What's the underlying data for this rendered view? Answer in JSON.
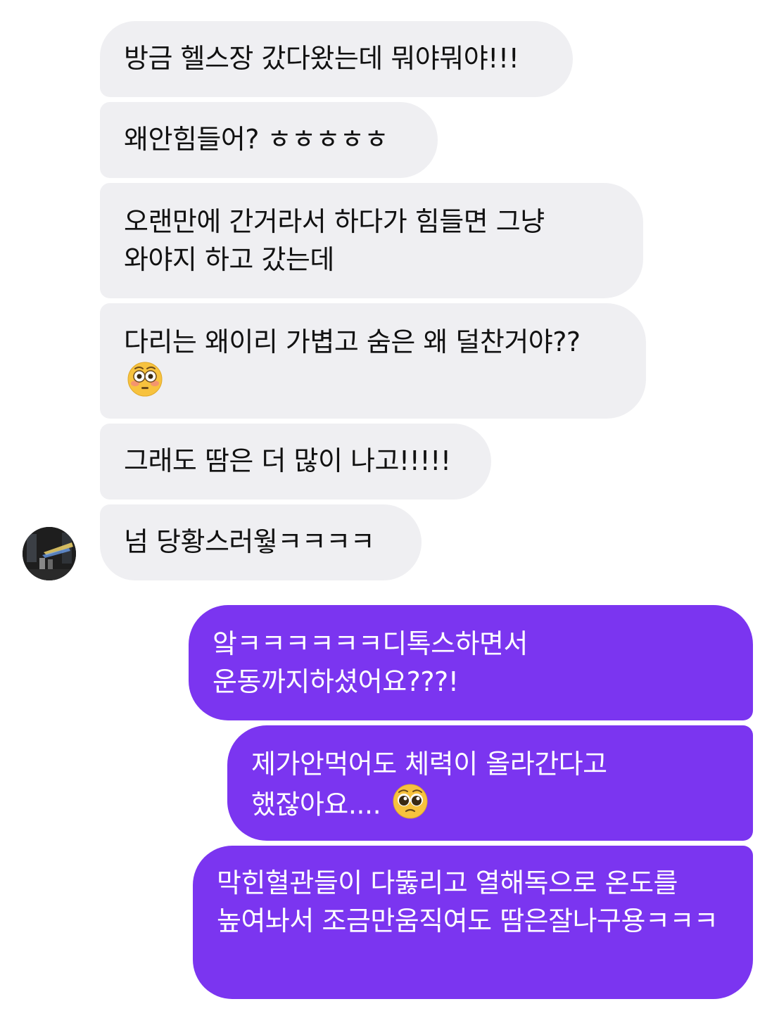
{
  "chat": {
    "incoming": [
      {
        "text": "방금 헬스장 갔다왔는데 뭐야뭐야!!!"
      },
      {
        "text": "왜안힘들어? ㅎㅎㅎㅎㅎ"
      },
      {
        "text": "오랜만에 간거라서 하다가 힘들면 그냥 와야지 하고 갔는데"
      },
      {
        "text": "다리는 왜이리 가볍고 숨은 왜 덜찬거야??",
        "emoji": "flushed-face"
      },
      {
        "text": "그래도 땀은 더 많이 나고!!!!!"
      },
      {
        "text": "넘 당황스러웧ㅋㅋㅋㅋ"
      }
    ],
    "outgoing": [
      {
        "text": "앜ㅋㅋㅋㅋㅋㅋ디톡스하면서 운동까지하셨어요???!"
      },
      {
        "text": "제가안먹어도 체력이 올라간다고 했잖아요....",
        "emoji": "pleading-face"
      },
      {
        "text": "막힌혈관들이 다뚫리고 열해독으로 온도를 높여놔서 조금만움직여도 땀은잘나구용ㅋㅋㅋ"
      }
    ],
    "colors": {
      "incoming_bubble": "#efeff2",
      "outgoing_bubble": "#7b35f0",
      "outgoing_text": "#ffffff"
    }
  }
}
